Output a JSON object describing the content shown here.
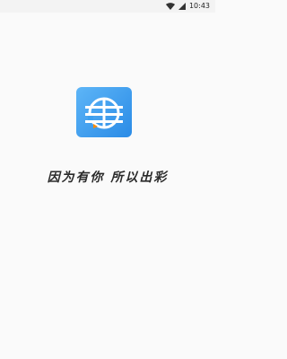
{
  "status_bar": {
    "time": "10:43",
    "icons": [
      "wifi-icon",
      "cellular-signal-icon"
    ]
  },
  "splash": {
    "logo": {
      "icon": "app-logo-icon",
      "colors": {
        "gradient_start": "#5db5f7",
        "gradient_end": "#2a8be6",
        "mark": "#ffffff",
        "accent": "#ff8a00"
      }
    },
    "slogan": "因为有你 所以出彩"
  },
  "colors": {
    "background": "#fafafa",
    "status_bar": "#f3f3f3",
    "text": "#2a2a2a"
  }
}
